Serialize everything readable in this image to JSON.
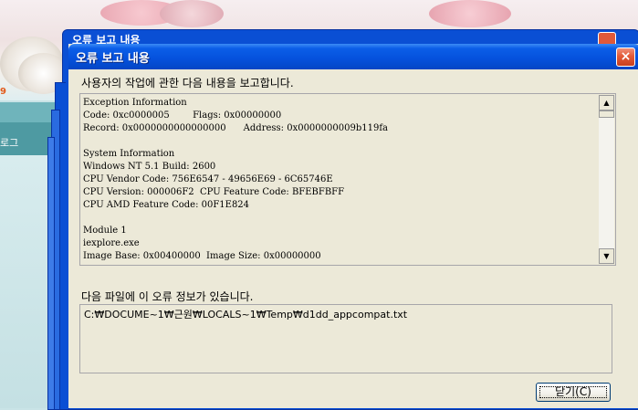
{
  "background": {
    "nav_label": "로그",
    "badge": "9"
  },
  "ghost_windows": {
    "title": "오류 보고 내용"
  },
  "dialog": {
    "title": "오류 보고 내용",
    "close_icon": "×",
    "intro": "사용자의 작업에 관한 다음 내용을 보고합니다.",
    "report_lines": [
      "Exception Information",
      "Code: 0xc0000005        Flags: 0x00000000",
      "Record: 0x0000000000000000      Address: 0x0000000009b119fa",
      "",
      "System Information",
      "Windows NT 5.1 Build: 2600",
      "CPU Vendor Code: 756E6547 - 49656E69 - 6C65746E",
      "CPU Version: 000006F2  CPU Feature Code: BFEBFBFF",
      "CPU AMD Feature Code: 00F1E824",
      "",
      "Module 1",
      "iexplore.exe",
      "Image Base: 0x00400000  Image Size: 0x00000000"
    ],
    "file_label": "다음 파일에 이 오류 정보가 있습니다.",
    "file_path": "C:₩DOCUME~1₩근원₩LOCALS~1₩Temp₩d1dd_appcompat.txt",
    "ok_label": "닫기(C)"
  },
  "colors": {
    "titlebar": "#0551dc",
    "dialog_bg": "#ece9d8",
    "close": "#e35a38"
  }
}
